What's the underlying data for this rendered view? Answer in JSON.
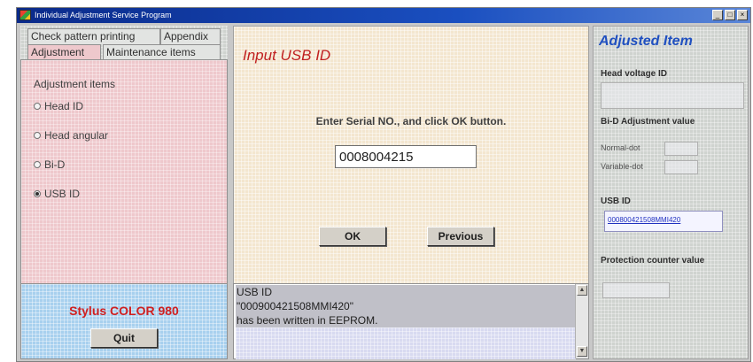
{
  "window": {
    "title": "Individual Adjustment Service Program",
    "buttons": [
      "_",
      "□",
      "×"
    ]
  },
  "tabs": {
    "row1": [
      "Check pattern printing",
      "Appendix"
    ],
    "row2": [
      "Adjustment",
      "Maintenance items"
    ]
  },
  "adjustment": {
    "group_label": "Adjustment items",
    "items": [
      {
        "label": "Head ID",
        "selected": false
      },
      {
        "label": "Head angular",
        "selected": false
      },
      {
        "label": "Bi-D",
        "selected": false
      },
      {
        "label": "USB ID",
        "selected": true
      }
    ]
  },
  "main": {
    "heading": "Input USB ID",
    "instruction": "Enter Serial NO., and click OK button.",
    "serial_value": "0008004215",
    "ok_label": "OK",
    "previous_label": "Previous"
  },
  "brand": {
    "model": "Stylus COLOR 980",
    "quit_label": "Quit"
  },
  "log": {
    "lines": [
      "USB ID",
      "\"000900421508MMI420\"",
      " has been written in EEPROM."
    ]
  },
  "adjusted": {
    "title": "Adjusted Item",
    "head_voltage_label": "Head voltage ID",
    "bid_label": "Bi-D Adjustment value",
    "normal_dot_label": "Normal-dot",
    "variable_dot_label": "Variable-dot",
    "usb_id_label": "USB ID",
    "usb_id_value": "000800421508MMI420",
    "protection_label": "Protection counter value"
  },
  "colors": {
    "title_bar": "#0a2a8a",
    "heading_red": "#c02020",
    "accent_blue": "#2050c0"
  }
}
